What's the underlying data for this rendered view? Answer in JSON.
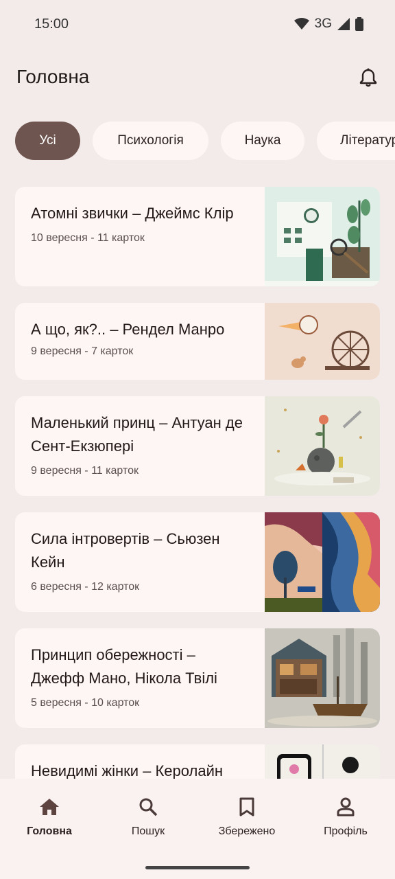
{
  "status_bar": {
    "time": "15:00",
    "network": "3G"
  },
  "header": {
    "title": "Головна"
  },
  "chips": [
    {
      "label": "Усі"
    },
    {
      "label": "Психологія"
    },
    {
      "label": "Наука"
    },
    {
      "label": "Літератур"
    }
  ],
  "cards": [
    {
      "title": "Атомні звички – Джеймс Клір",
      "meta": "10 вересня - 11 карток"
    },
    {
      "title": "А що, як?.. – Рендел Манро",
      "meta": "9 вересня - 7 карток"
    },
    {
      "title": "Маленький принц – Антуан де Сент-Екзюпері",
      "meta": "9 вересня - 11 карток"
    },
    {
      "title": "Сила інтровертів – Сьюзен Кейн",
      "meta": "6 вересня - 12 карток"
    },
    {
      "title": "Принцип обережності – Джефф Мано, Нікола Твілі",
      "meta": "5 вересня - 10 карток"
    },
    {
      "title": "Невидимі жінки – Керолайн",
      "meta": ""
    }
  ],
  "bottom_nav": {
    "items": [
      {
        "label": "Головна",
        "icon": "home-icon"
      },
      {
        "label": "Пошук",
        "icon": "search-icon"
      },
      {
        "label": "Збережено",
        "icon": "bookmark-icon"
      },
      {
        "label": "Профіль",
        "icon": "person-icon"
      }
    ]
  },
  "colors": {
    "background": "#f3ebea",
    "surface": "#fdf6f5",
    "accent": "#6f5550"
  }
}
